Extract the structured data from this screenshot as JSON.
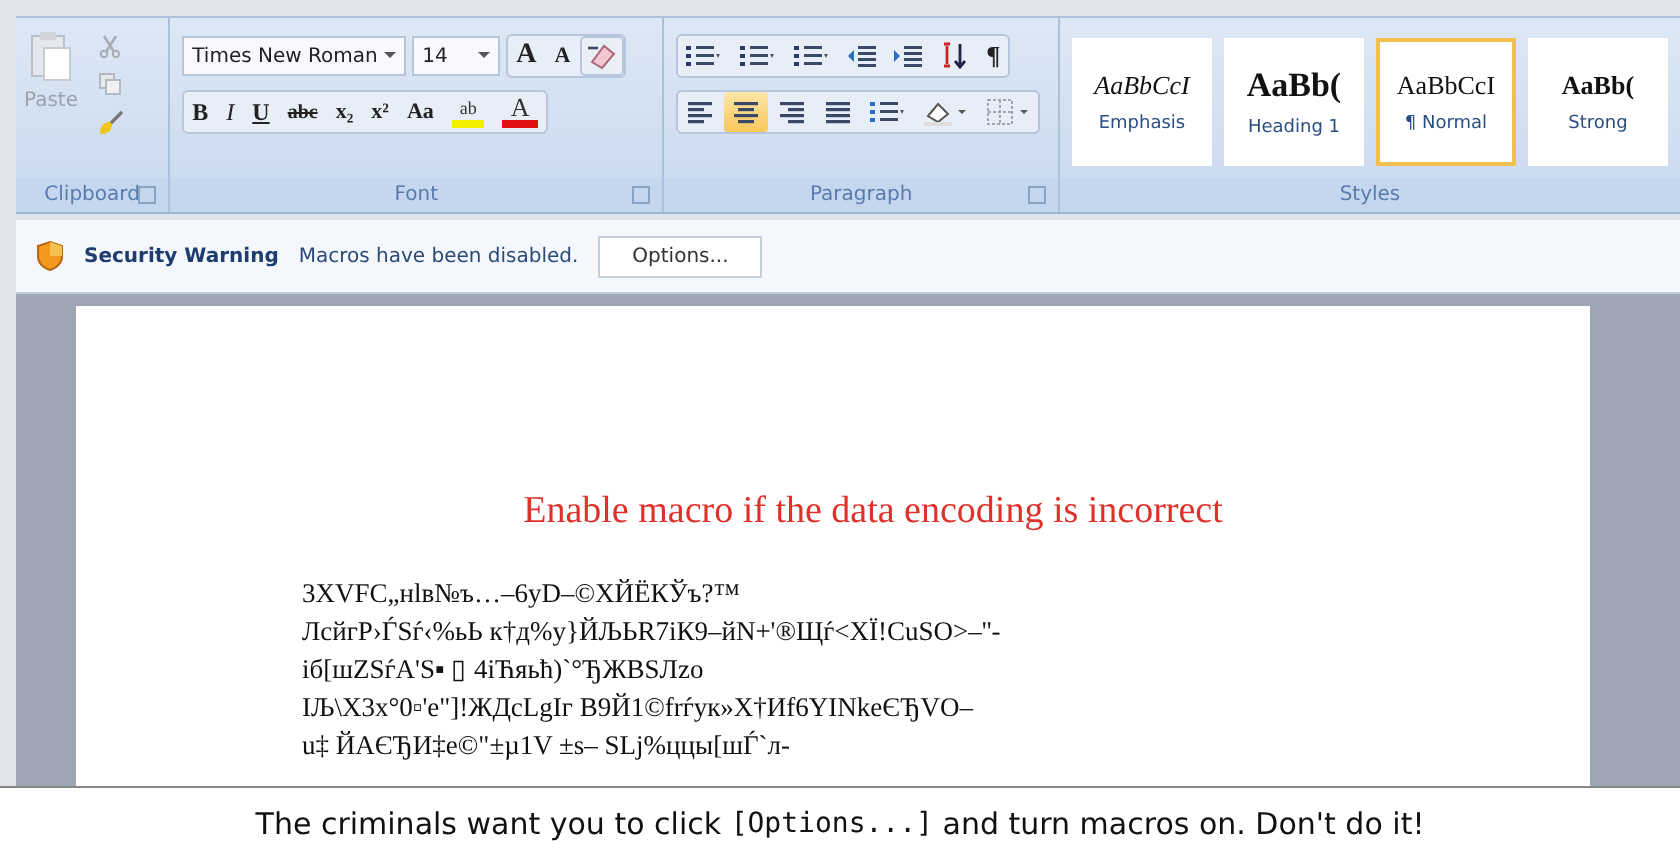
{
  "ribbon": {
    "clipboard": {
      "label": "Clipboard",
      "paste": "Paste"
    },
    "font": {
      "label": "Font",
      "font_name": "Times New Roman",
      "font_size": "14",
      "row1": [
        {
          "kind": "grow",
          "label": "A"
        },
        {
          "kind": "shrink",
          "label": "A"
        },
        {
          "kind": "clear"
        }
      ],
      "row2": [
        {
          "kind": "bold",
          "label": "B"
        },
        {
          "kind": "italic",
          "label": "I"
        },
        {
          "kind": "underline",
          "label": "U"
        },
        {
          "kind": "strike",
          "label": "abc"
        },
        {
          "kind": "sub",
          "label": "x₂"
        },
        {
          "kind": "sup",
          "label": "x²"
        },
        {
          "kind": "case",
          "label": "Aa"
        },
        {
          "kind": "highlight",
          "label": "ab"
        },
        {
          "kind": "color",
          "label": "A"
        }
      ]
    },
    "paragraph": {
      "label": "Paragraph",
      "row1": [
        {
          "kind": "bullets",
          "selected": false
        },
        {
          "kind": "numbering",
          "selected": false
        },
        {
          "kind": "multilevel",
          "selected": false
        },
        {
          "kind": "outdent",
          "selected": false
        },
        {
          "kind": "indent",
          "selected": false
        },
        {
          "kind": "sort",
          "selected": false
        },
        {
          "kind": "pilcrow",
          "label": "¶",
          "selected": false
        }
      ],
      "row2": [
        {
          "kind": "left",
          "selected": false
        },
        {
          "kind": "center",
          "selected": true
        },
        {
          "kind": "right",
          "selected": false
        },
        {
          "kind": "justify",
          "selected": false
        },
        {
          "kind": "spacing",
          "selected": false
        },
        {
          "kind": "shading",
          "selected": false
        },
        {
          "kind": "borders",
          "selected": false
        }
      ]
    },
    "styles": {
      "label": "Styles",
      "items": [
        {
          "preview": "AaBbCcI",
          "name": "Emphasis",
          "kind": "emphasis",
          "selected": false
        },
        {
          "preview": "AaBb(",
          "name": "Heading 1",
          "kind": "heading",
          "selected": false
        },
        {
          "preview": "AaBbCcI",
          "name": "¶ Normal",
          "kind": "normal",
          "selected": true
        },
        {
          "preview": "AaBb(",
          "name": "Strong",
          "kind": "strong",
          "selected": false
        }
      ]
    }
  },
  "security_bar": {
    "title": "Security Warning",
    "message": "Macros have been disabled.",
    "button": "Options..."
  },
  "document": {
    "heading": "Enable macro if the data encoding is incorrect",
    "lines": [
      "3XVFC„нlв№ъ…–6уD–©ХЙЁКЎъ?™",
      "ЛсйгР›ЃЅѓ‹%ьЬ к†д%у}ЙЉЬR7іК9–йN+'®Щѓ<ХЇ!СuЅО>–''-",
      "іб[шZЅѓА'Ѕ▪ ▯ 4іЋяьћ)`°ЂЖВЅЛzо",
      "ІЉ\\Х3х°0▫'е\"]!ЖДсLgІг   В9Й1©frѓук»Х†Иf6YINkеЄЂVО–",
      "u‡ ЙАЄЂИ‡е©\"±µ1V   ±s– ЅLj%ццы[шЃ`л-"
    ]
  },
  "caption": {
    "before": "The criminals want you to click",
    "code": "[Options...]",
    "after": "and turn macros on. Don't do it!"
  }
}
